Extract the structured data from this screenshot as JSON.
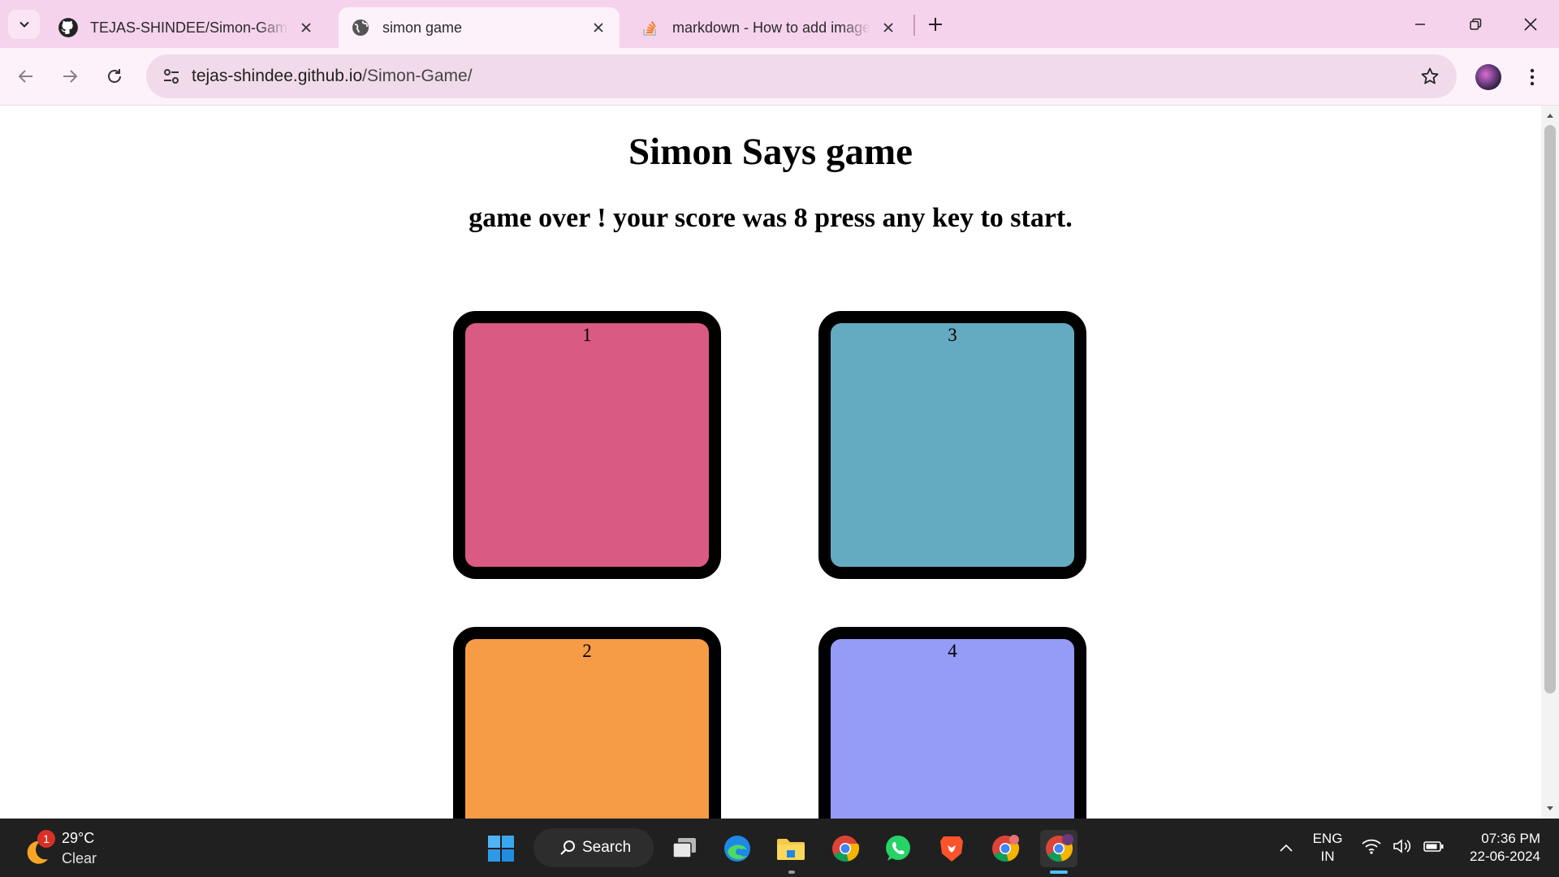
{
  "browser": {
    "tabs": [
      {
        "title": "TEJAS-SHINDEE/Simon-Game: v",
        "favicon": "github-icon",
        "active": false
      },
      {
        "title": "simon game",
        "favicon": "globe-icon",
        "active": true
      },
      {
        "title": "markdown - How to add image",
        "favicon": "stackoverflow-icon",
        "active": false
      }
    ],
    "url_host": "tejas-shindee.github.io",
    "url_path": "/Simon-Game/"
  },
  "page": {
    "title": "Simon Says game",
    "status": "game over ! your score was 8 press any key to start.",
    "buttons": [
      {
        "label": "1",
        "color": "#d95a82"
      },
      {
        "label": "3",
        "color": "#64aac1"
      },
      {
        "label": "2",
        "color": "#f79c46"
      },
      {
        "label": "4",
        "color": "#949cf8"
      }
    ]
  },
  "taskbar": {
    "weather_temp": "29°C",
    "weather_condition": "Clear",
    "weather_badge": "1",
    "search_label": "Search",
    "language_line1": "ENG",
    "language_line2": "IN",
    "time": "07:36 PM",
    "date": "22-06-2024"
  },
  "colors": {
    "tab_strip": "#f6d3ec",
    "toolbar": "#fdf2fa",
    "omnibox": "#f1dbeb",
    "taskbar": "#202020"
  }
}
